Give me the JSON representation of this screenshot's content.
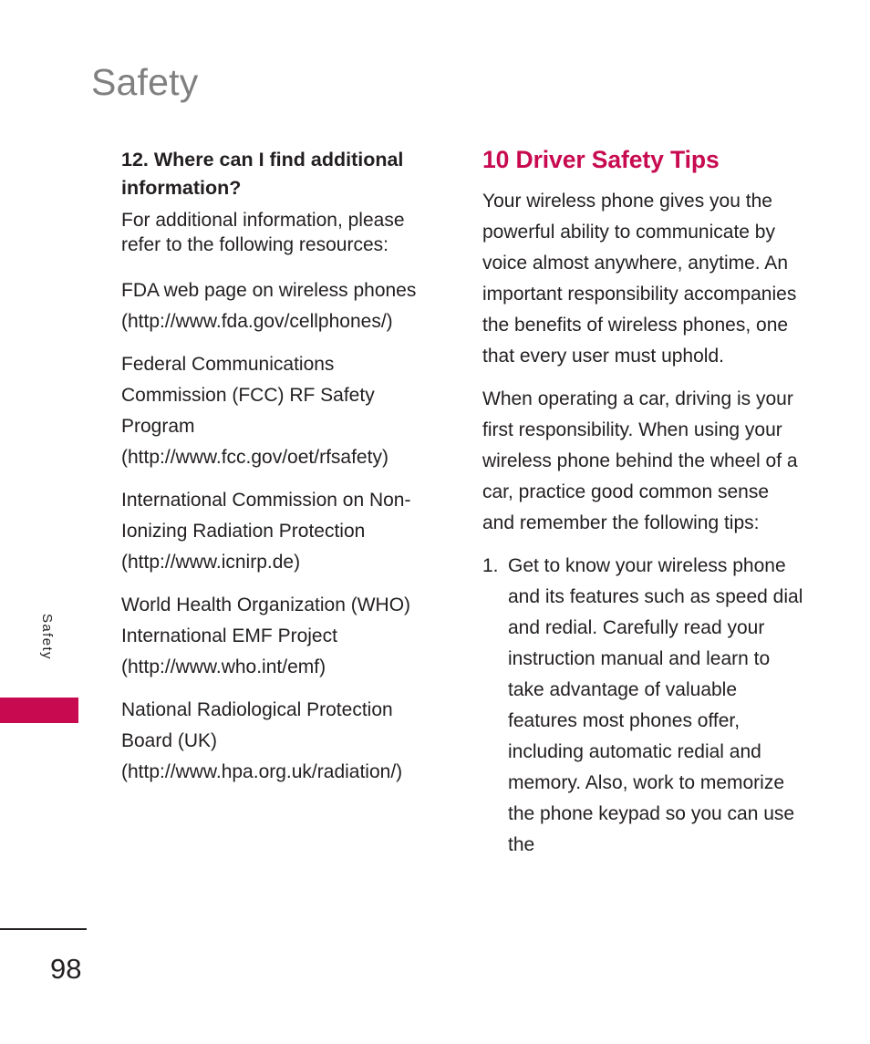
{
  "page": {
    "chapter_title": "Safety",
    "side_tab_label": "Safety",
    "page_number": "98",
    "accent_color": "#c80a50",
    "title_color": "#808080",
    "text_color": "#231f20"
  },
  "left_column": {
    "subheading": "12. Where can I find additional information?",
    "paragraphs": [
      "For additional information, please refer to the following resources:",
      "FDA web page on wireless phones (http://www.fda.gov/cellphones/)",
      "Federal Communications Commission (FCC) RF Safety Program (http://www.fcc.gov/oet/rfsafety)",
      "International Commission on Non-Ionizing Radiation Protection (http://www.icnirp.de)",
      "World Health Organization (WHO) International EMF Project (http://www.who.int/emf)",
      "National Radiological Protection Board (UK) (http://www.hpa.org.uk/radiation/)"
    ]
  },
  "right_column": {
    "heading": "10 Driver Safety Tips",
    "paragraphs": [
      "Your wireless phone gives you the powerful ability to communicate by voice almost anywhere, anytime. An important responsibility accompanies the benefits of wireless phones, one that every user must uphold.",
      "When operating a car, driving is your first responsibility. When using your wireless phone behind the wheel of a car, practice good common sense and remember the following tips:"
    ],
    "tips": [
      {
        "number": "1.",
        "text": "Get to know your wireless phone and its features such as speed dial and redial. Carefully read your instruction manual and learn to take advantage of valuable features most phones offer, including automatic redial and memory. Also, work to memorize the phone keypad so you can use the"
      }
    ]
  }
}
